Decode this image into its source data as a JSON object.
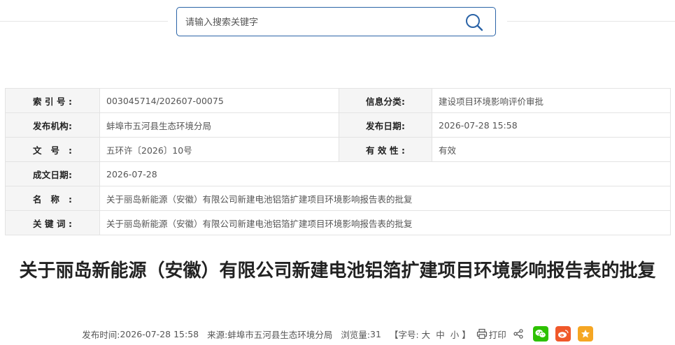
{
  "search": {
    "placeholder": "请输入搜索关键字"
  },
  "info": {
    "index_label": "索引号:",
    "index_value": "003045714/202607-00075",
    "category_label": "信息分类:",
    "category_value": "建设项目环境影响评价审批",
    "publisher_label": "发布机构:",
    "publisher_value": "蚌埠市五河县生态环境分局",
    "pubdate_label": "发布日期:",
    "pubdate_value": "2026-07-28 15:58",
    "docno_label": "文号:",
    "docno_value": "五环许〔2026〕10号",
    "validity_label": "有效性:",
    "validity_value": "有效",
    "created_label": "成文日期:",
    "created_value": "2026-07-28",
    "name_label": "名称:",
    "name_value": "关于丽岛新能源（安徽）有限公司新建电池铝箔扩建项目环境影响报告表的批复",
    "keywords_label": "关键词:",
    "keywords_value": "关于丽岛新能源（安徽）有限公司新建电池铝箔扩建项目环境影响报告表的批复"
  },
  "article": {
    "title": "关于丽岛新能源（安徽）有限公司新建电池铝箔扩建项目环境影响报告表的批复",
    "meta": {
      "time_label": "发布时间:",
      "time_value": "2026-07-28 15:58",
      "source_label": "来源:",
      "source_value": "蚌埠市五河县生态环境分局",
      "views_label": "浏览量:",
      "views_value": "31",
      "fontsize_prefix": "【字号:",
      "size_large": "大",
      "size_medium": "中",
      "size_small": "小",
      "fontsize_suffix": "】",
      "print_label": "打印"
    }
  },
  "icons": {
    "wechat": "wechat-icon",
    "weibo": "weibo-icon",
    "favorite": "star-icon",
    "share": "share-icon",
    "print": "printer-icon",
    "search": "search-icon"
  },
  "colors": {
    "search_border": "#2b64a7",
    "wechat": "#2dc100",
    "weibo": "#f0582a",
    "favorite": "#f5a623"
  }
}
